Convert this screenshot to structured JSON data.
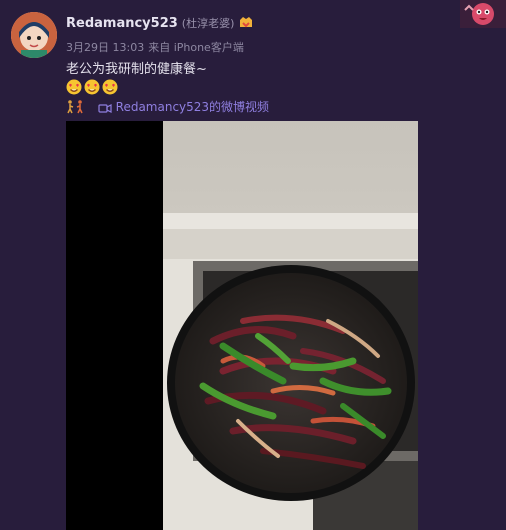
{
  "post": {
    "username": "Redamancy523",
    "remark": "(杜淳老婆)",
    "date": "3月29日 13:03",
    "source": "来自 iPhone客户端",
    "text": "老公为我研制的健康餐~",
    "video_link": "Redamancy523的微博视频"
  },
  "icons": {
    "vip_badge": "vip-badge-icon",
    "emoji": "heart-eyes-emoji-icon",
    "video_link": "video-camera-icon",
    "walk": "walking-icons"
  },
  "colors": {
    "background": "#281d3c",
    "link": "#8f7fe0",
    "meta": "#8d87a1"
  }
}
